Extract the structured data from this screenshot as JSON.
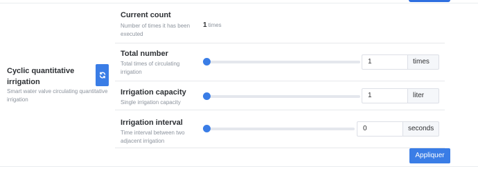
{
  "section": {
    "title": "Cyclic quantitative irrigation",
    "description": "Smart water valve circulating quantitative irrigation",
    "refresh_icon": "refresh-icon"
  },
  "current_count": {
    "title": "Current count",
    "description": "Number of times it has been executed",
    "value": "1",
    "unit": "times"
  },
  "total_number": {
    "title": "Total number",
    "description": "Total times of circulating irrigation",
    "value": "1",
    "unit": "times",
    "slider_level": 0
  },
  "irrigation_capacity": {
    "title": "Irrigation capacity",
    "description": "Single irrigation capacity",
    "value": "1",
    "unit": "liter",
    "slider_level": 0
  },
  "irrigation_interval": {
    "title": "Irrigation interval",
    "description": "Time interval between two adjacent irrigation",
    "value": "0",
    "unit": "seconds",
    "slider_level": 0
  },
  "apply_label": "Appliquer",
  "colors": {
    "accent": "#3a7de6",
    "muted_text": "#8c939d",
    "border": "#dcdfe6"
  }
}
